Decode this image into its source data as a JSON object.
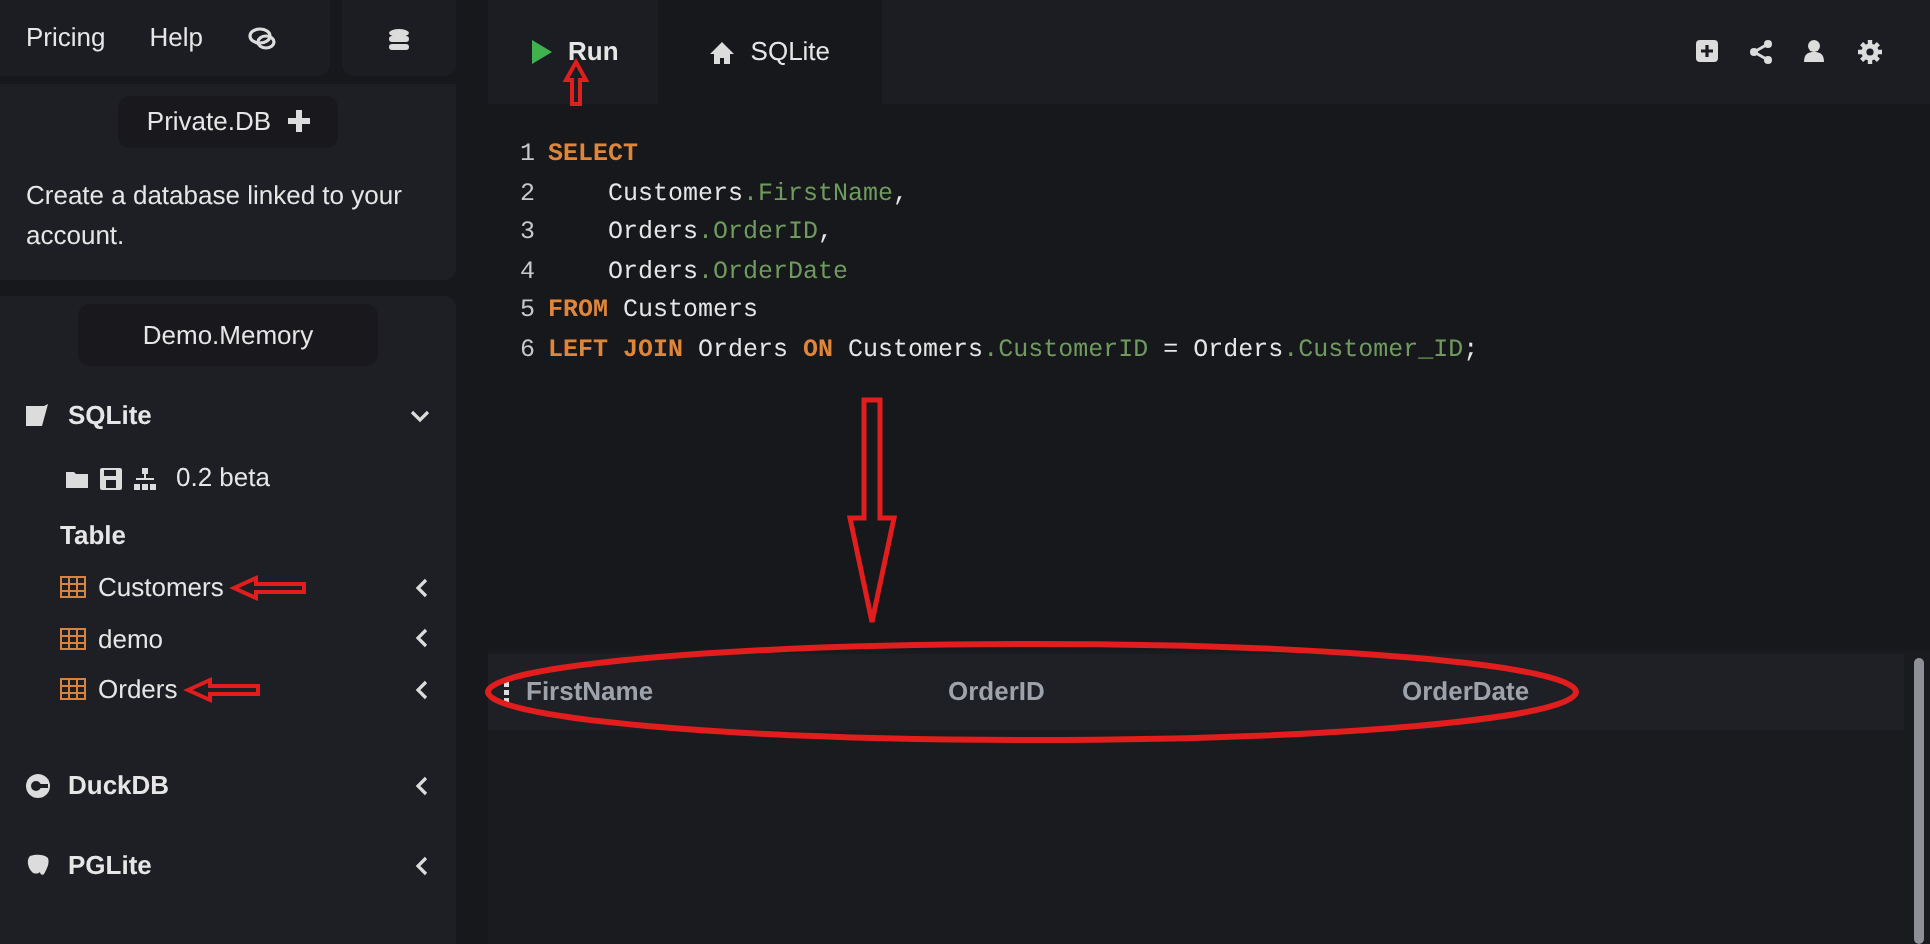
{
  "topnav": {
    "links": [
      "Pricing",
      "Help"
    ]
  },
  "private_db": {
    "label": "Private.DB",
    "description": "Create a database linked to your account."
  },
  "demo_button": "Demo.Memory",
  "engines": [
    {
      "name": "SQLite",
      "expanded": true,
      "kind": "sqlite"
    },
    {
      "name": "DuckDB",
      "expanded": false,
      "kind": "duckdb"
    },
    {
      "name": "PGLite",
      "expanded": false,
      "kind": "pglite"
    }
  ],
  "sqlite_panel": {
    "version": "0.2 beta",
    "section": "Table",
    "tables": [
      {
        "name": "Customers",
        "expanded": false,
        "marked": true
      },
      {
        "name": "demo",
        "expanded": false,
        "marked": false
      },
      {
        "name": "Orders",
        "expanded": false,
        "marked": true
      }
    ]
  },
  "toolbar": {
    "run": {
      "label": "Run",
      "marked": true
    },
    "tabs": [
      {
        "label": "SQLite",
        "selected": true
      }
    ]
  },
  "editor": {
    "arrow_below": true,
    "lines": [
      [
        {
          "kind": "keyword",
          "s": "SELECT"
        }
      ],
      [
        {
          "kind": "plain",
          "s": "    Customers"
        },
        {
          "kind": "column",
          "s": ".FirstName"
        },
        {
          "kind": "plain",
          "s": ","
        }
      ],
      [
        {
          "kind": "plain",
          "s": "    Orders"
        },
        {
          "kind": "column",
          "s": ".OrderID"
        },
        {
          "kind": "plain",
          "s": ","
        }
      ],
      [
        {
          "kind": "plain",
          "s": "    Orders"
        },
        {
          "kind": "column",
          "s": ".OrderDate"
        }
      ],
      [
        {
          "kind": "keyword",
          "s": "FROM"
        },
        {
          "kind": "plain",
          "s": " Customers"
        }
      ],
      [
        {
          "kind": "keyword",
          "s": "LEFT JOIN"
        },
        {
          "kind": "plain",
          "s": " Orders "
        },
        {
          "kind": "keyword",
          "s": "ON"
        },
        {
          "kind": "plain",
          "s": " Customers"
        },
        {
          "kind": "column",
          "s": ".CustomerID"
        },
        {
          "kind": "plain",
          "s": " = Orders"
        },
        {
          "kind": "column",
          "s": ".Customer_ID"
        },
        {
          "kind": "plain",
          "s": ";"
        }
      ]
    ]
  },
  "line_numbers": [
    "1",
    "2",
    "3",
    "4",
    "5",
    "6"
  ],
  "results": {
    "marked": true,
    "columns": [
      "FirstName",
      "OrderID",
      "OrderDate"
    ]
  }
}
